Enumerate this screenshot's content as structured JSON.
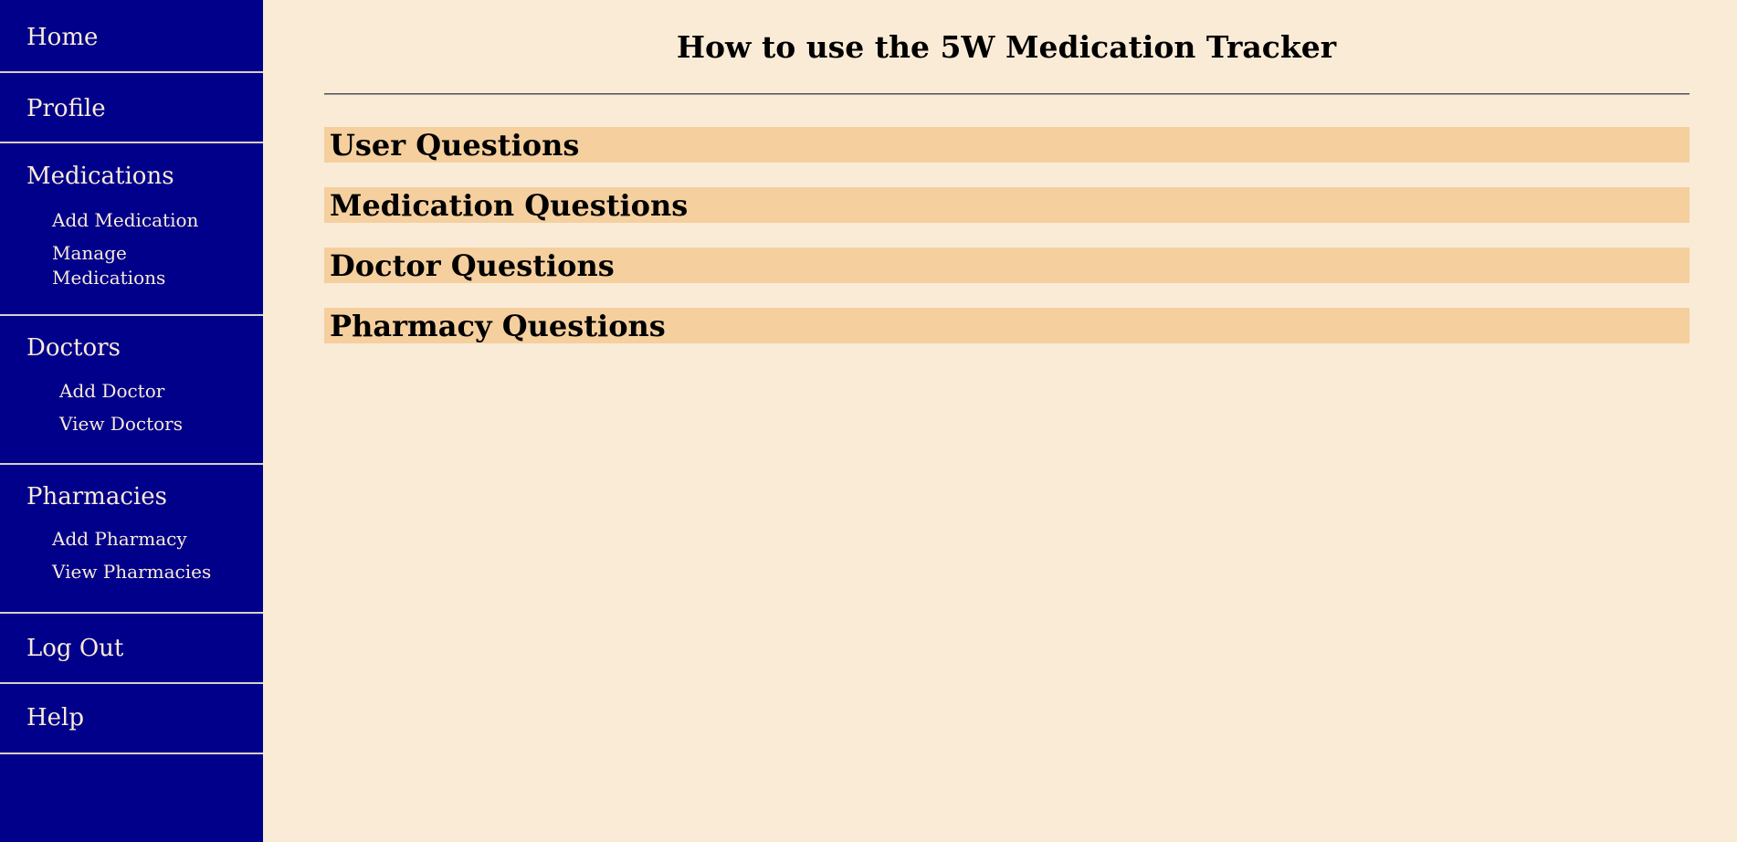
{
  "sidebar": {
    "home": "Home",
    "profile": "Profile",
    "medications": {
      "label": "Medications",
      "items": [
        "Add Medication",
        "Manage Medications"
      ]
    },
    "doctors": {
      "label": "Doctors",
      "items": [
        "Add Doctor",
        "View Doctors"
      ]
    },
    "pharmacies": {
      "label": "Pharmacies",
      "items": [
        "Add Pharmacy",
        "View Pharmacies"
      ]
    },
    "logout": "Log Out",
    "help": "Help"
  },
  "main": {
    "title": "How to use the 5W Medication Tracker",
    "sections": [
      "User Questions",
      "Medication Questions",
      "Doctor Questions",
      "Pharmacy Questions"
    ]
  },
  "colors": {
    "sidebar_bg": "#00008b",
    "page_bg": "#faebd7",
    "section_header_bg": "#f5cf9e"
  }
}
